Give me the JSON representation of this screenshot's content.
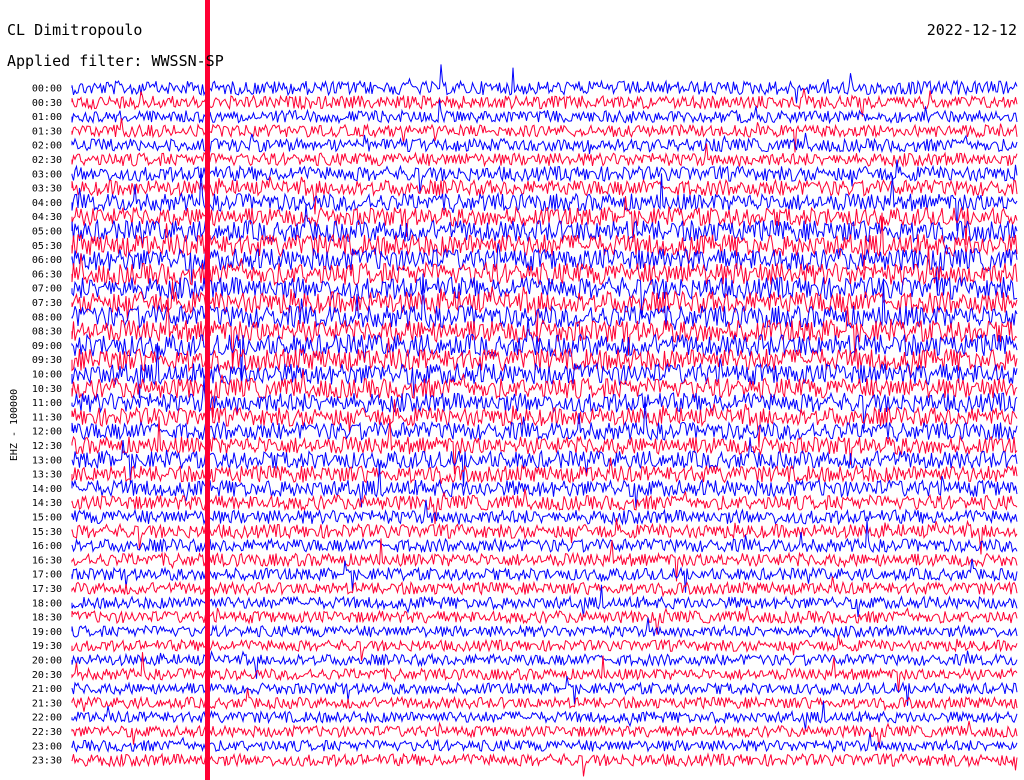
{
  "header": {
    "station": "CL Dimitropoulo",
    "filter": "Applied filter: WWSSN-SP",
    "date": "2022-12-12"
  },
  "channel_label": "EHZ - 100000",
  "colors": {
    "trace_a": "#0000ff",
    "trace_b": "#ff0033",
    "background": "#ffffff",
    "text": "#000000"
  },
  "chart_data": {
    "type": "line",
    "subtype": "helicorder",
    "title": "CL Dimitropoulo",
    "subtitle": "Applied filter: WWSSN-SP",
    "date": "2022-12-12",
    "ylabel": "EHZ - 100000",
    "row_labels": [
      "00:00",
      "00:30",
      "01:00",
      "01:30",
      "02:00",
      "02:30",
      "03:00",
      "03:30",
      "04:00",
      "04:30",
      "05:00",
      "05:30",
      "06:00",
      "06:30",
      "07:00",
      "07:30",
      "08:00",
      "08:30",
      "09:00",
      "09:30",
      "10:00",
      "10:30",
      "11:00",
      "11:30",
      "12:00",
      "12:30",
      "13:00",
      "13:30",
      "14:00",
      "14:30",
      "15:00",
      "15:30",
      "16:00",
      "16:30",
      "17:00",
      "17:30",
      "18:00",
      "18:30",
      "19:00",
      "19:30",
      "20:00",
      "20:30",
      "21:00",
      "21:30",
      "22:00",
      "22:30",
      "23:00",
      "23:30"
    ],
    "row_minutes": 30,
    "trace_colors": [
      "#0000ff",
      "#ff0033"
    ],
    "relative_amplitude": [
      0.55,
      0.5,
      0.45,
      0.45,
      0.5,
      0.5,
      0.6,
      0.65,
      0.75,
      0.8,
      0.95,
      1.0,
      1.0,
      1.0,
      1.0,
      1.0,
      1.0,
      1.0,
      1.0,
      1.0,
      0.95,
      0.9,
      0.85,
      0.8,
      0.75,
      0.75,
      0.75,
      0.7,
      0.7,
      0.6,
      0.55,
      0.55,
      0.5,
      0.5,
      0.45,
      0.45,
      0.45,
      0.45,
      0.4,
      0.4,
      0.4,
      0.4,
      0.4,
      0.4,
      0.4,
      0.4,
      0.4,
      0.45
    ]
  }
}
